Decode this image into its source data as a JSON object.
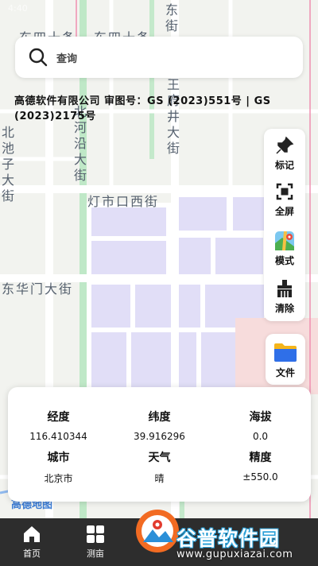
{
  "status_bar": {
    "time": "4:40"
  },
  "map": {
    "streets": {
      "top_left": "东四十条",
      "top_right": "东四十条",
      "east_street": "东街",
      "wangfujing": "王府井大街",
      "north_river": "北河沿大街",
      "north_pool": "北池子大街",
      "dengshikou": "灯市口西街",
      "donghuamen": "东华门大街"
    },
    "copyright": "高德软件有限公司 审图号：GS (2023)551号 | GS (2023)2175号",
    "logo_text": "高德地图"
  },
  "search": {
    "placeholder": "查询"
  },
  "toolbar": {
    "mark_label": "标记",
    "fullscreen_label": "全屏",
    "mode_label": "模式",
    "clear_label": "清除",
    "file_label": "文件"
  },
  "info": {
    "longitude_label": "经度",
    "longitude_value": "116.410344",
    "latitude_label": "纬度",
    "latitude_value": "39.916296",
    "altitude_label": "海拔",
    "altitude_value": "0.0",
    "city_label": "城市",
    "city_value": "北京市",
    "weather_label": "天气",
    "weather_value": "晴",
    "accuracy_label": "精度",
    "accuracy_value": "±550.0"
  },
  "bottom_nav": {
    "home_label": "首页",
    "measure_label": "测亩"
  },
  "watermark": {
    "title": "谷普软件园",
    "url": "www.gupuxiazai.com"
  },
  "colors": {
    "block": "#e1def7",
    "green_strip": "#b9e6c1",
    "pink_area": "#f7dcdc",
    "map_bg": "#f2f3ef"
  }
}
